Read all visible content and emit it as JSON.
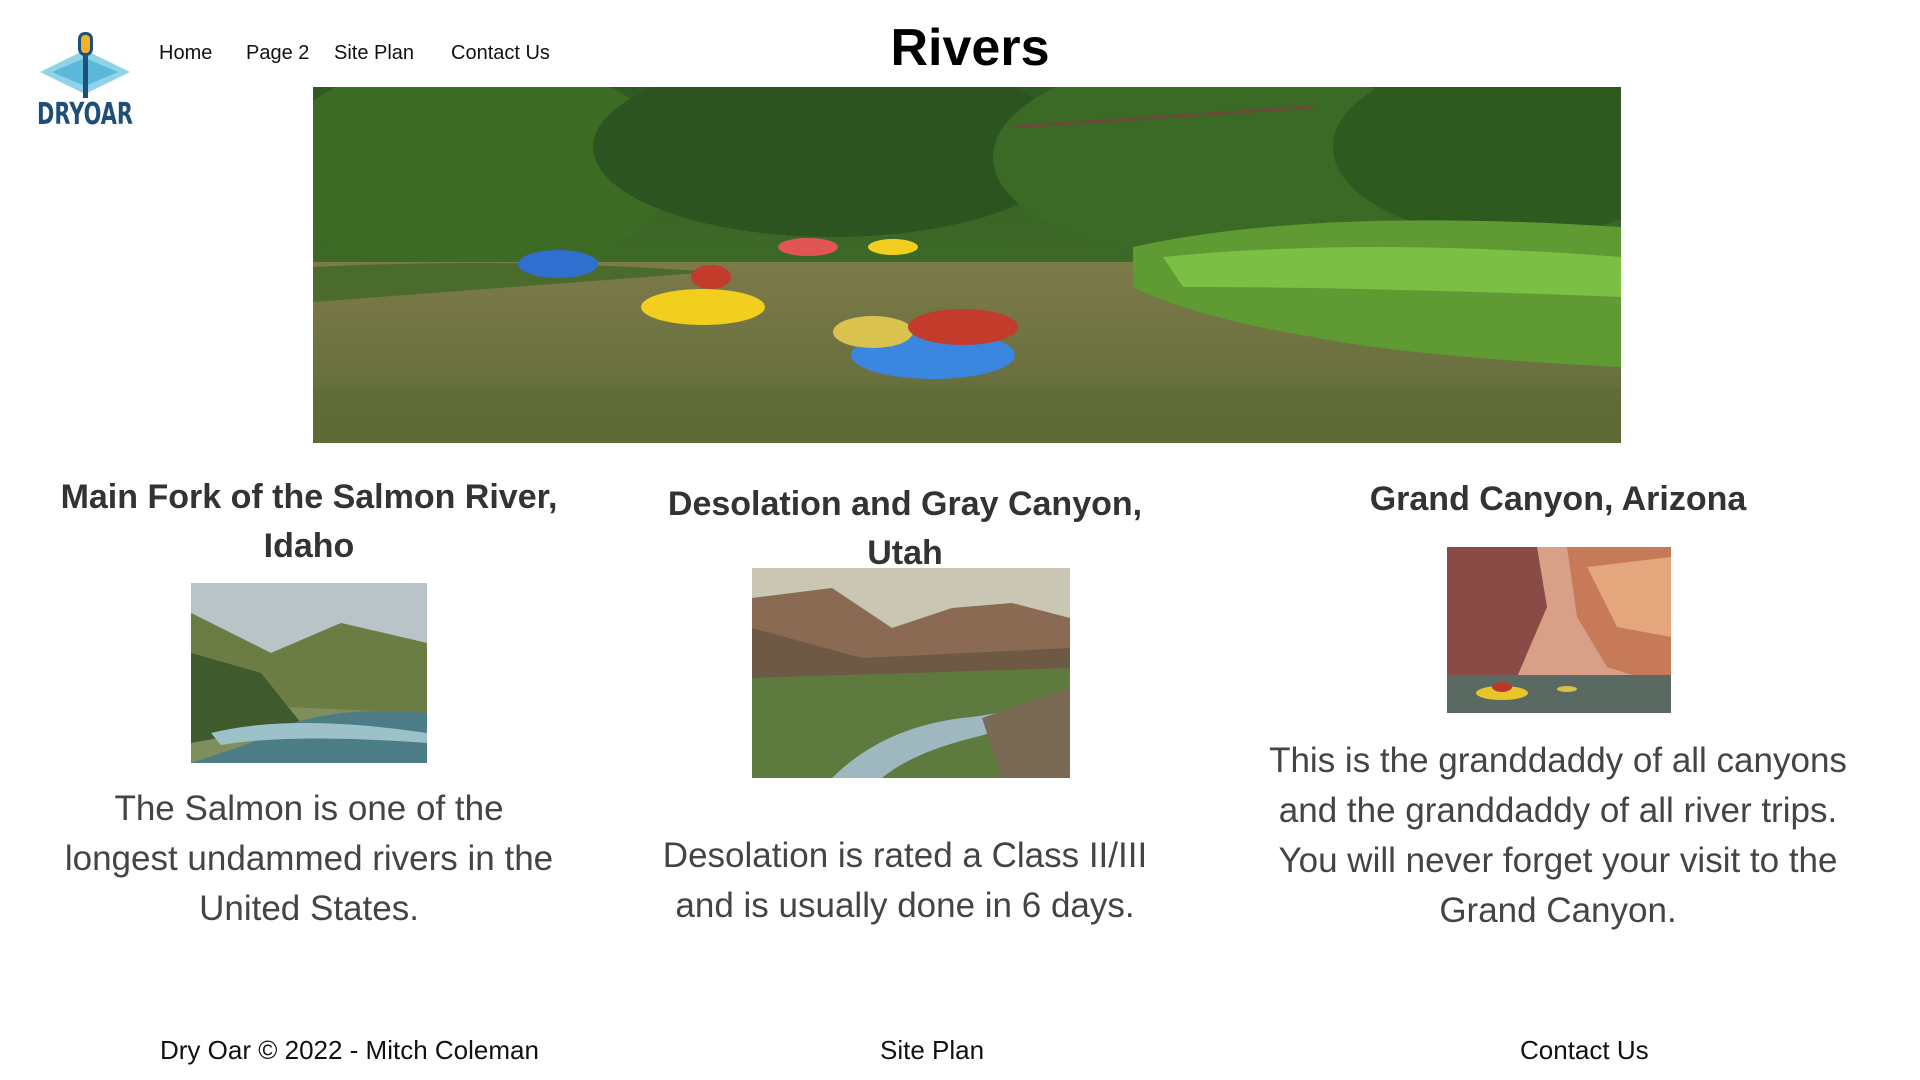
{
  "header": {
    "logo_text": "DRYOAR",
    "title": "Rivers",
    "nav": [
      "Home",
      "Page 2",
      "Site Plan",
      "Contact Us"
    ]
  },
  "hero": {
    "image": "rafting-on-jungle-river"
  },
  "rivers": [
    {
      "heading": "Main Fork of the Salmon River, Idaho",
      "image": "salmon-river-canyon",
      "text": "The Salmon is one of the longest undammed rivers in the United States."
    },
    {
      "heading": "Desolation and Gray Canyon, Utah",
      "image": "desolation-canyon",
      "text": "Desolation is rated a Class II/III and is usually done in 6 days."
    },
    {
      "heading": "Grand Canyon, Arizona",
      "image": "grand-canyon-raft",
      "text": "This is the granddaddy of all canyons and the granddaddy of all river trips. You will never forget your visit to the Grand Canyon."
    }
  ],
  "footer": {
    "copyright": "Dry Oar © 2022 - Mitch Coleman",
    "site_plan": "Site Plan",
    "contact": "Contact Us"
  },
  "colors": {
    "logo_blue": "#1f4e79",
    "logo_light": "#8fd3e8",
    "logo_gold": "#f0b323",
    "heading": "#333333",
    "text": "#444444"
  }
}
